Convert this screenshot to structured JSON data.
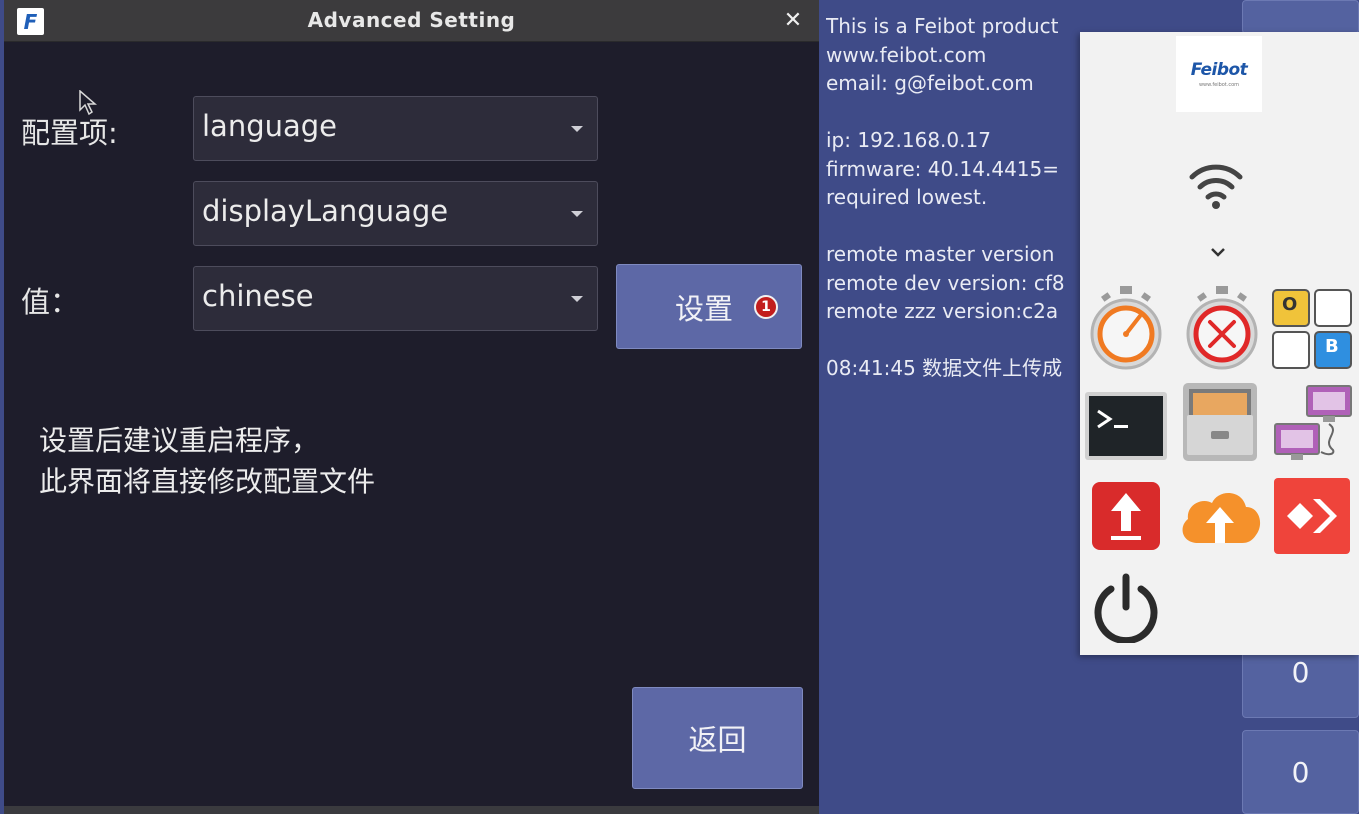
{
  "background": {
    "info_lines": [
      "This is a Feibot product",
      "www.feibot.com",
      "email: g@feibot.com",
      "",
      "ip: 192.168.0.17",
      "firmware: 40.14.4415=",
      "required lowest.",
      "",
      "remote master version",
      "remote dev version: cf8",
      "remote zzz version:c2a",
      "",
      "08:41:45 数据文件上传成"
    ],
    "counters": [
      "0",
      "0"
    ]
  },
  "launcher": {
    "logo_text": "Feibot",
    "logo_tagline": "www.feibot.com",
    "chevron": "⌄",
    "grid_letters": [
      "O",
      "B"
    ],
    "icons": [
      "wifi-icon",
      "speed-timer-icon",
      "stop-timer-icon",
      "ob-grid-icon",
      "terminal-icon",
      "file-cabinet-icon",
      "network-computers-icon",
      "upload-icon",
      "cloud-upload-icon",
      "anydesk-icon",
      "power-icon"
    ]
  },
  "dialog": {
    "app_icon_letter": "F",
    "title": "Advanced Setting",
    "close_glyph": "✕",
    "config_label": "配置项:",
    "value_label": "值：",
    "combo_section": "language",
    "combo_key": "displayLanguage",
    "combo_value": "chinese",
    "set_button": "设置",
    "badge": "1",
    "hint_line1": "设置后建议重启程序，",
    "hint_line2": "此界面将直接修改配置文件",
    "back_button": "返回"
  },
  "colors": {
    "dialog_bg": "#1e1d2b",
    "background_app": "#3f4b88",
    "button_bg": "#5d68a6",
    "badge_red": "#c21d1d"
  }
}
